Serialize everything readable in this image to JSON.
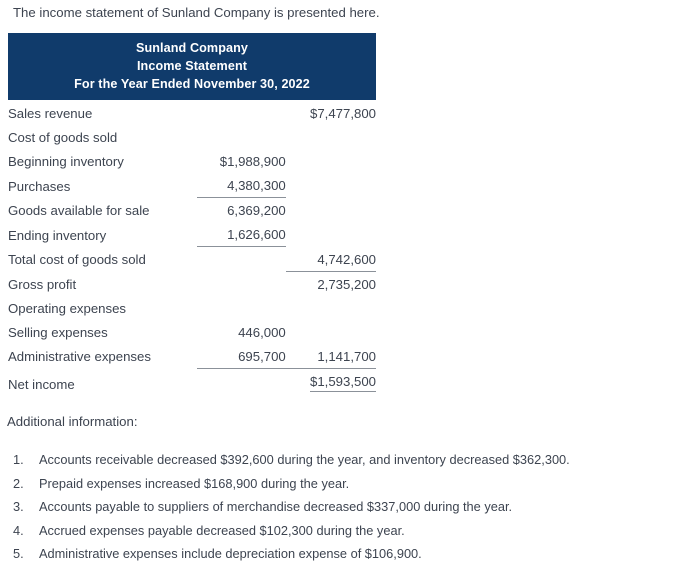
{
  "intro": {
    "text": "The income statement of Sunland Company is presented here."
  },
  "statement": {
    "header": {
      "line1": "Sunland Company",
      "line2": "Income Statement",
      "line3": "For the Year Ended November 30, 2022",
      "background_color": "#103b6b",
      "text_color": "#ffffff"
    },
    "rows": [
      {
        "label": "Sales revenue",
        "indent": 0,
        "col1": "",
        "col2": "$7,477,800",
        "col1_rule": "none",
        "col2_rule": "none"
      },
      {
        "label": "Cost of goods sold",
        "indent": 0,
        "col1": "",
        "col2": "",
        "col1_rule": "none",
        "col2_rule": "none"
      },
      {
        "label": "Beginning inventory",
        "indent": 1,
        "col1": "$1,988,900",
        "col2": "",
        "col1_rule": "none",
        "col2_rule": "none"
      },
      {
        "label": "Purchases",
        "indent": 1,
        "col1": "4,380,300",
        "col2": "",
        "col1_rule": "bottom",
        "col2_rule": "none"
      },
      {
        "label": "Goods available for sale",
        "indent": 1,
        "col1": "6,369,200",
        "col2": "",
        "col1_rule": "none",
        "col2_rule": "none"
      },
      {
        "label": "Ending inventory",
        "indent": 1,
        "col1": "1,626,600",
        "col2": "",
        "col1_rule": "bottom",
        "col2_rule": "none"
      },
      {
        "label": "Total cost of goods sold",
        "indent": 0,
        "col1": "",
        "col2": "4,742,600",
        "col1_rule": "none",
        "col2_rule": "bottom"
      },
      {
        "label": "Gross profit",
        "indent": 0,
        "col1": "",
        "col2": "2,735,200",
        "col1_rule": "none",
        "col2_rule": "none"
      },
      {
        "label": "Operating expenses",
        "indent": 0,
        "col1": "",
        "col2": "",
        "col1_rule": "none",
        "col2_rule": "none"
      },
      {
        "label": "Selling expenses",
        "indent": 1,
        "col1": "446,000",
        "col2": "",
        "col1_rule": "none",
        "col2_rule": "none"
      },
      {
        "label": "Administrative expenses",
        "indent": 1,
        "col1": "695,700",
        "col2": "1,141,700",
        "col1_rule": "bottom",
        "col2_rule": "bottom"
      },
      {
        "label": "Net income",
        "indent": 0,
        "col1": "",
        "col2": "$1,593,500",
        "col1_rule": "none",
        "col2_rule": "double"
      }
    ]
  },
  "additional_information": {
    "title": "Additional information:",
    "items": [
      {
        "number": "1.",
        "text": "Accounts receivable decreased $392,600 during the year, and inventory decreased $362,300."
      },
      {
        "number": "2.",
        "text": "Prepaid expenses increased $168,900 during the year."
      },
      {
        "number": "3.",
        "text": "Accounts payable to suppliers of merchandise decreased $337,000 during the year."
      },
      {
        "number": "4.",
        "text": "Accrued expenses payable decreased $102,300 during the year."
      },
      {
        "number": "5.",
        "text": "Administrative expenses include depreciation expense of $106,900."
      }
    ]
  }
}
